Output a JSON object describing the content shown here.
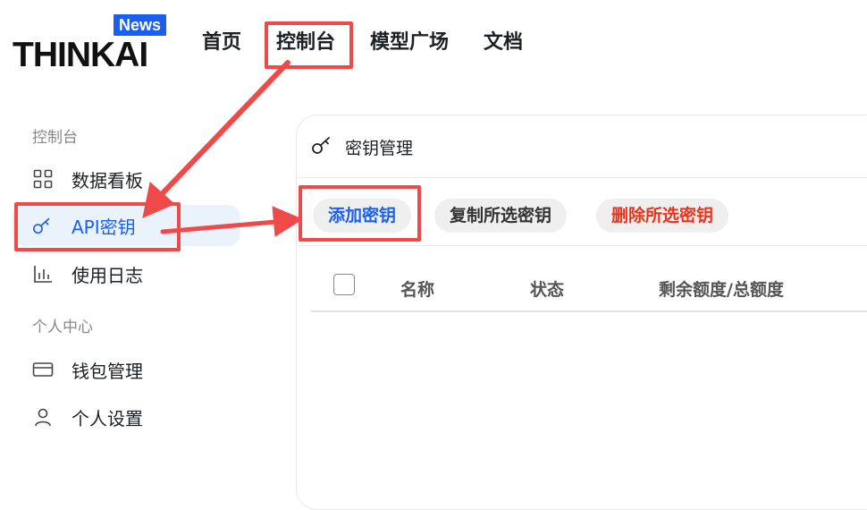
{
  "logo": {
    "text": "THINKAI",
    "badge": "News"
  },
  "topnav": {
    "items": [
      "首页",
      "控制台",
      "模型广场",
      "文档"
    ]
  },
  "sidebar": {
    "groups": [
      {
        "title": "控制台",
        "items": [
          {
            "label": "数据看板",
            "icon": "dashboard-icon"
          },
          {
            "label": "API密钥",
            "icon": "key-icon",
            "active": true
          },
          {
            "label": "使用日志",
            "icon": "bar-chart-icon"
          }
        ]
      },
      {
        "title": "个人中心",
        "items": [
          {
            "label": "钱包管理",
            "icon": "wallet-icon"
          },
          {
            "label": "个人设置",
            "icon": "user-icon"
          }
        ]
      }
    ]
  },
  "main": {
    "title": "密钥管理",
    "buttons": {
      "add": "添加密钥",
      "copy": "复制所选密钥",
      "delete": "删除所选密钥"
    },
    "table": {
      "headers": [
        "名称",
        "状态",
        "剩余额度/总额度"
      ]
    }
  },
  "colors": {
    "accent": "#1a5ff0",
    "danger": "#e8341c",
    "highlight": "#ef4a4a",
    "active_bg": "#eaf2fc"
  }
}
